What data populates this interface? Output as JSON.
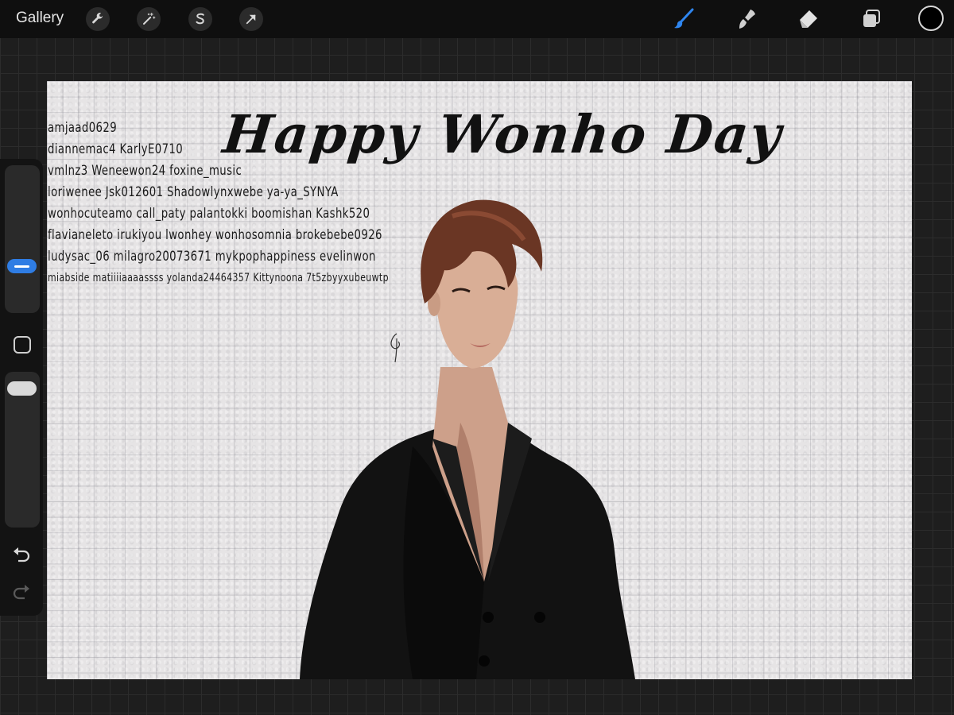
{
  "topbar": {
    "gallery_label": "Gallery",
    "left_tools": [
      {
        "name": "wrench-icon"
      },
      {
        "name": "magic-wand-icon"
      },
      {
        "name": "selection-s-icon"
      },
      {
        "name": "transform-arrow-icon"
      }
    ],
    "right_tools": [
      {
        "name": "brush-icon",
        "active": true
      },
      {
        "name": "smudge-icon"
      },
      {
        "name": "eraser-icon"
      },
      {
        "name": "layers-icon"
      }
    ],
    "active_color": "#000000",
    "accent_color": "#1f7ae0"
  },
  "sidebar": {
    "brush_size_level": 0.2,
    "opacity_level": 0.05,
    "icons": [
      "modify-square-icon",
      "undo-icon",
      "redo-icon"
    ]
  },
  "canvas": {
    "title": "Happy Wonho Day",
    "name_lines": [
      "amjaad0629",
      "diannemac4 KarlyE0710",
      "vmlnz3 Weneewon24 foxine_music",
      "loriwenee Jsk012601 Shadowlynxwebe ya-ya_SYNYA",
      "wonhocuteamo call_paty palantokki boomishan Kashk520",
      "flavianeleto irukiyou lwonhey wonhosomnia brokebebe0926",
      "ludysac_06 milagro20073671 mykpophappiness evelinwon",
      "miabside matiiiiaaaassss yolanda24464357 Kittynoona 7t5zbyyxubeuwtp"
    ]
  }
}
